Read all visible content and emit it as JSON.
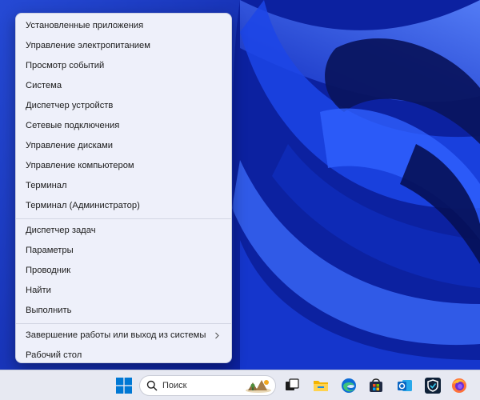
{
  "context_menu": {
    "groups": [
      {
        "items": [
          {
            "label": "Установленные приложения"
          },
          {
            "label": "Управление электропитанием"
          },
          {
            "label": "Просмотр событий"
          },
          {
            "label": "Система"
          },
          {
            "label": "Диспетчер устройств"
          },
          {
            "label": "Сетевые подключения"
          },
          {
            "label": "Управление дисками"
          },
          {
            "label": "Управление компьютером"
          },
          {
            "label": "Терминал"
          },
          {
            "label": "Терминал (Администратор)"
          }
        ]
      },
      {
        "items": [
          {
            "label": "Диспетчер задач"
          },
          {
            "label": "Параметры"
          },
          {
            "label": "Проводник"
          },
          {
            "label": "Найти"
          },
          {
            "label": "Выполнить"
          }
        ]
      },
      {
        "items": [
          {
            "label": "Завершение работы или выход из системы",
            "has_submenu": true
          },
          {
            "label": "Рабочий стол"
          }
        ]
      }
    ]
  },
  "taskbar": {
    "search": {
      "placeholder": "Поиск"
    },
    "apps": [
      {
        "icon": "windows-start-icon"
      },
      {
        "icon": "task-view-icon"
      },
      {
        "icon": "file-explorer-icon"
      },
      {
        "icon": "edge-browser-icon"
      },
      {
        "icon": "microsoft-store-icon"
      },
      {
        "icon": "outlook-icon"
      },
      {
        "icon": "shield-app-icon"
      },
      {
        "icon": "firefox-icon"
      }
    ]
  },
  "colors": {
    "menu_bg": "#eef0fa",
    "taskbar_bg": "#e7e9f2",
    "wallpaper_accent": "#1a3fe0"
  }
}
